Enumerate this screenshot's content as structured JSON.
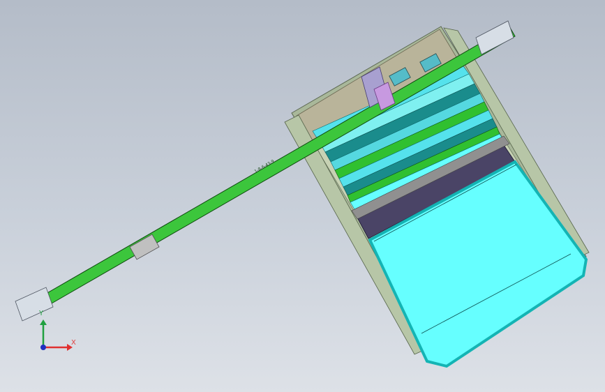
{
  "viewport": {
    "background_top": "#b4bcc8",
    "background_bottom": "#dde1e7"
  },
  "model": {
    "rail_label": "1-8-6-43-9",
    "colors": {
      "frame": "#a9b89a",
      "rail": "#3cc63c",
      "tray_fill": "#66ffff",
      "tray_border": "#14b4b4",
      "slider": "#c799e0",
      "divider_dark": "#4a4466",
      "cyan_slat": "#55e2ec",
      "teal_slat": "#1a8c8c",
      "green_slat": "#30c030",
      "tan_plate": "#b9b49a"
    }
  },
  "triad": {
    "x_label": "X",
    "y_label": "Y",
    "x_color": "#e03030",
    "y_color": "#20a040",
    "z_color": "#2030c0"
  }
}
